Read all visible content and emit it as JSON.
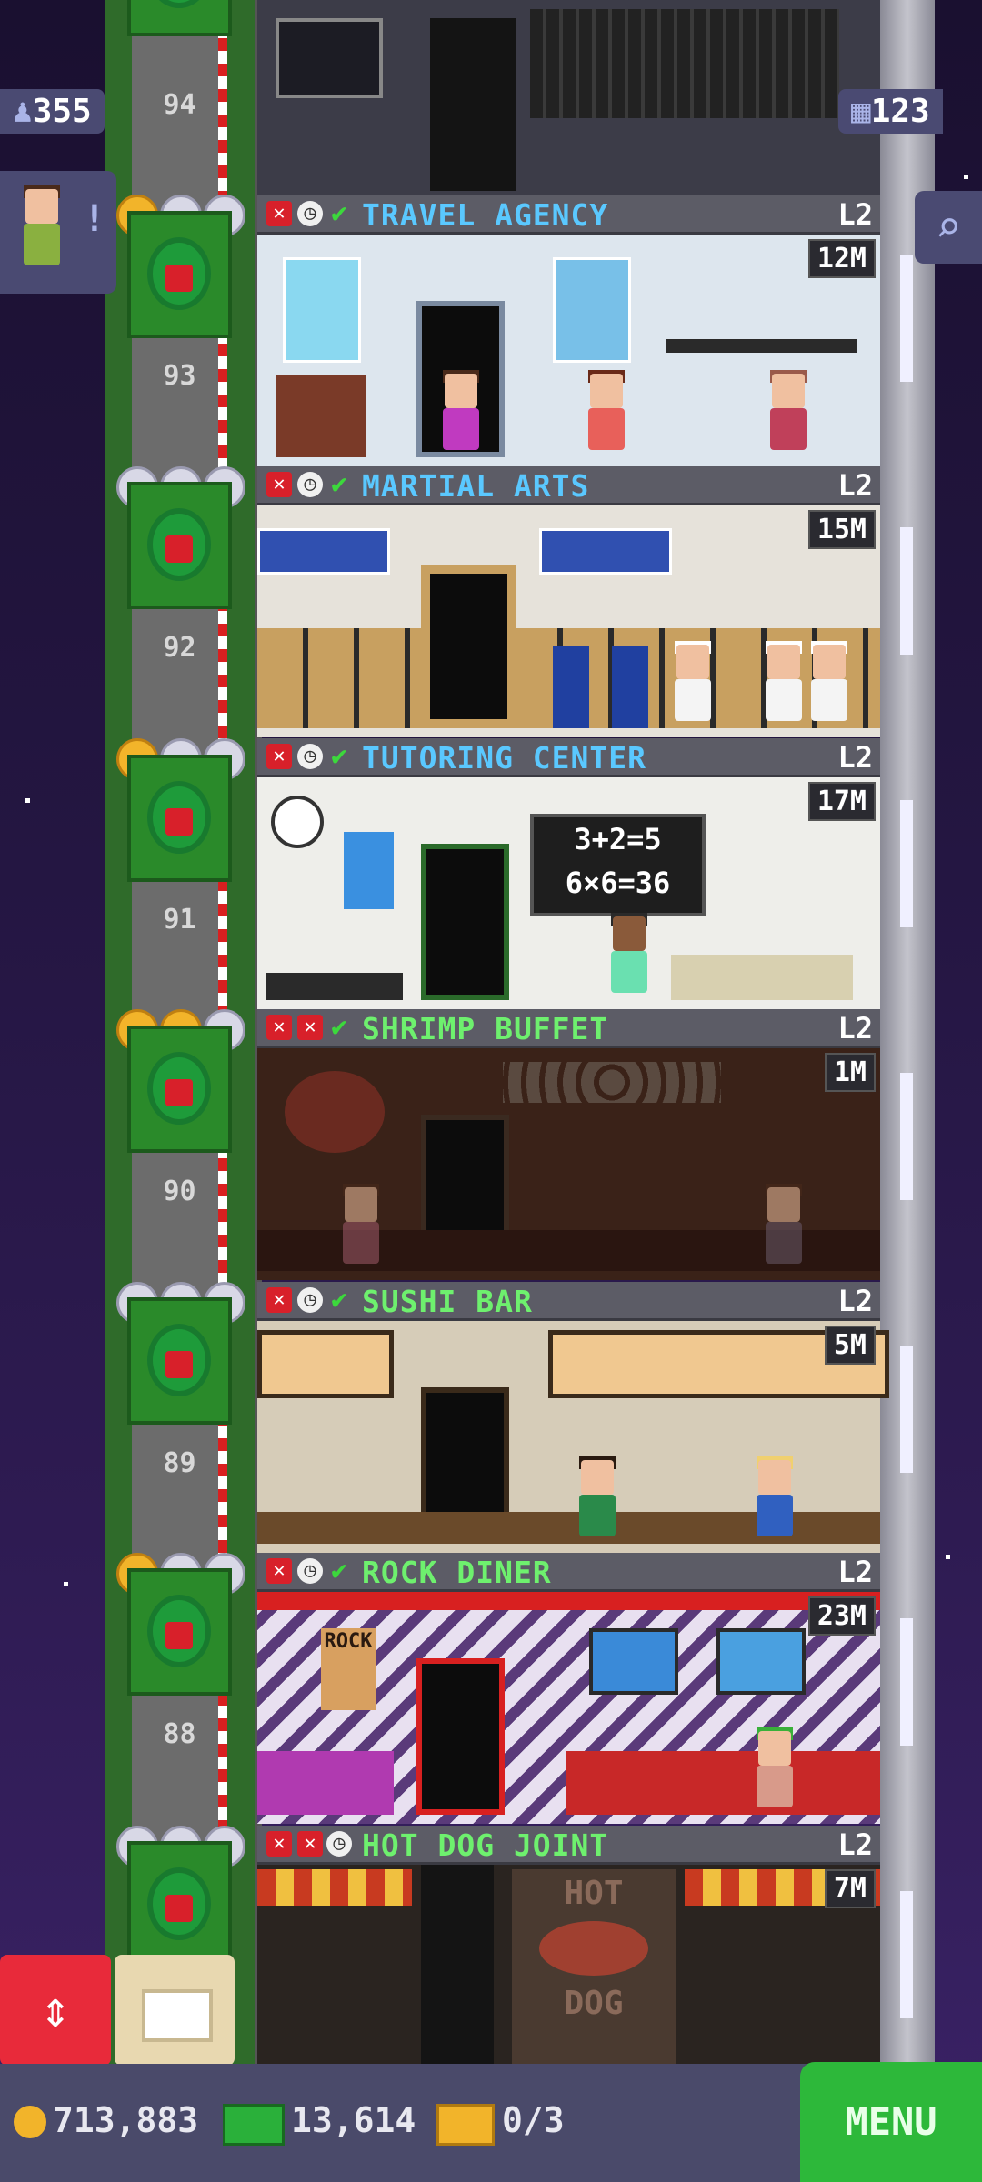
{
  "hud": {
    "population": "355",
    "floors_count": "123",
    "coins": "713,883",
    "bux": "13,614",
    "tickets": "0/3",
    "menu_label": "MENU"
  },
  "floor_numbers": [
    "94",
    "93",
    "92",
    "91",
    "90",
    "89",
    "88"
  ],
  "floors": [
    {
      "name": "TRAVEL AGENCY",
      "level": "L2",
      "stock": "12M",
      "name_color": "#5ac8ff",
      "status": [
        "x",
        "clock",
        "ok"
      ]
    },
    {
      "name": "MARTIAL ARTS",
      "level": "L2",
      "stock": "15M",
      "name_color": "#5ac8ff",
      "status": [
        "x",
        "clock",
        "ok"
      ]
    },
    {
      "name": "TUTORING CENTER",
      "level": "L2",
      "stock": "17M",
      "name_color": "#5ac8ff",
      "status": [
        "x",
        "clock",
        "ok"
      ]
    },
    {
      "name": "SHRIMP BUFFET",
      "level": "L2",
      "stock": "1M",
      "name_color": "#6ef06e",
      "status": [
        "x",
        "x",
        "ok"
      ]
    },
    {
      "name": "SUSHI BAR",
      "level": "L2",
      "stock": "5M",
      "name_color": "#6ef06e",
      "status": [
        "x",
        "clock",
        "ok"
      ]
    },
    {
      "name": "ROCK DINER",
      "level": "L2",
      "stock": "23M",
      "name_color": "#6ef06e",
      "status": [
        "x",
        "clock",
        "ok"
      ]
    },
    {
      "name": "HOT DOG JOINT",
      "level": "L2",
      "stock": "7M",
      "name_color": "#6ef06e",
      "status": [
        "x",
        "x",
        "clock"
      ]
    }
  ],
  "tutoring_board": {
    "line1": "3+2=5",
    "line2": "6×6=36"
  },
  "hotdog_sign": {
    "top": "HOT",
    "bottom": "DOG"
  },
  "diner_sign": "ROCK",
  "icons": [
    "person-icon",
    "grid-icon",
    "search-icon",
    "elevator-arrows-icon",
    "build-box-icon",
    "coin-icon",
    "bux-icon",
    "ticket-icon"
  ]
}
